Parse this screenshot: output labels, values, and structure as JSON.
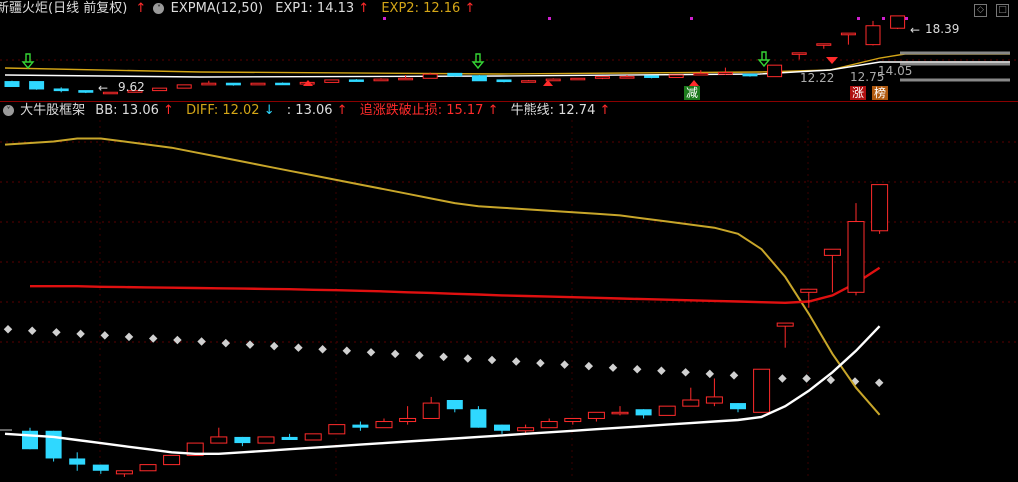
{
  "top_legend": {
    "stock_name": "新疆火炬(日线 前复权)",
    "arrow": "🠙",
    "indicator": "EXPMA(12,50)",
    "exp1_label": "EXP1: 14.13",
    "exp1_arrow": "↑",
    "exp2_label": "EXP2: 12.16",
    "exp2_arrow": "↑"
  },
  "top_labels": {
    "high_price": "18.39",
    "low_price": "9.62",
    "price_a": "12.22",
    "price_b": "12.75",
    "price_c": "14.05",
    "signal_reduce": "减",
    "signal_rise": "涨",
    "signal_list": "榜"
  },
  "bottom_legend": {
    "indicator": "大牛股框架",
    "bb_label": "BB: 13.06",
    "bb_arrow": "↑",
    "diff_label": "DIFF: 12.02",
    "diff_arrow": "↓",
    "third_label": ": 13.06",
    "third_arrow": "↑",
    "stop_label": "追涨跌破止损: 15.17",
    "stop_arrow": "↑",
    "bear_label": "牛熊线: 12.74",
    "bear_arrow": "↑"
  },
  "colors": {
    "up": "#ff2b2b",
    "down": "#2fd8ff",
    "exp2": "#d4a617",
    "diff": "#c8a62a",
    "stop": "#e01010",
    "bear": "#ffffff",
    "dots": "#d0d0d0"
  },
  "icons": {
    "collapse": "circle-chevron-icon",
    "settings": "circle-chevron-icon",
    "window": "window-control-icons"
  },
  "chart_data": {
    "type": "candlestick",
    "panels": [
      "price-overview",
      "大牛股框架"
    ],
    "candles": [
      {
        "o": 10.9,
        "c": 11.5,
        "h": 11.6,
        "l": 10.9,
        "dir": "down"
      },
      {
        "o": 11.5,
        "c": 10.6,
        "h": 11.5,
        "l": 10.5,
        "dir": "down"
      },
      {
        "o": 10.6,
        "c": 10.4,
        "h": 10.8,
        "l": 10.2,
        "dir": "down"
      },
      {
        "o": 10.4,
        "c": 10.2,
        "h": 10.4,
        "l": 10.1,
        "dir": "down"
      },
      {
        "o": 10.1,
        "c": 10.2,
        "h": 10.2,
        "l": 10.0,
        "dir": "up"
      },
      {
        "o": 10.2,
        "c": 10.4,
        "h": 10.4,
        "l": 10.2,
        "dir": "up"
      },
      {
        "o": 10.4,
        "c": 10.7,
        "h": 10.7,
        "l": 10.4,
        "dir": "up"
      },
      {
        "o": 10.7,
        "c": 11.1,
        "h": 11.1,
        "l": 10.7,
        "dir": "up"
      },
      {
        "o": 11.1,
        "c": 11.3,
        "h": 11.6,
        "l": 11.1,
        "dir": "up"
      },
      {
        "o": 11.3,
        "c": 11.1,
        "h": 11.3,
        "l": 11.0,
        "dir": "down"
      },
      {
        "o": 11.1,
        "c": 11.3,
        "h": 11.3,
        "l": 11.1,
        "dir": "up"
      },
      {
        "o": 11.3,
        "c": 11.2,
        "h": 11.4,
        "l": 11.2,
        "dir": "down"
      },
      {
        "o": 11.2,
        "c": 11.4,
        "h": 11.4,
        "l": 11.2,
        "dir": "up"
      },
      {
        "o": 11.4,
        "c": 11.7,
        "h": 11.7,
        "l": 11.4,
        "dir": "up"
      },
      {
        "o": 11.7,
        "c": 11.6,
        "h": 11.8,
        "l": 11.5,
        "dir": "down"
      },
      {
        "o": 11.6,
        "c": 11.8,
        "h": 11.9,
        "l": 11.6,
        "dir": "up"
      },
      {
        "o": 11.8,
        "c": 11.9,
        "h": 12.3,
        "l": 11.7,
        "dir": "up"
      },
      {
        "o": 11.9,
        "c": 12.4,
        "h": 12.6,
        "l": 11.9,
        "dir": "up"
      },
      {
        "o": 12.5,
        "c": 12.2,
        "h": 12.5,
        "l": 12.1,
        "dir": "down"
      },
      {
        "o": 12.2,
        "c": 11.6,
        "h": 12.3,
        "l": 11.6,
        "dir": "down"
      },
      {
        "o": 11.7,
        "c": 11.5,
        "h": 11.7,
        "l": 11.4,
        "dir": "down"
      },
      {
        "o": 11.5,
        "c": 11.6,
        "h": 11.7,
        "l": 11.4,
        "dir": "up"
      },
      {
        "o": 11.6,
        "c": 11.8,
        "h": 11.9,
        "l": 11.6,
        "dir": "up"
      },
      {
        "o": 11.8,
        "c": 11.9,
        "h": 11.9,
        "l": 11.7,
        "dir": "up"
      },
      {
        "o": 11.9,
        "c": 12.1,
        "h": 12.1,
        "l": 11.8,
        "dir": "up"
      },
      {
        "o": 12.1,
        "c": 12.1,
        "h": 12.3,
        "l": 12.0,
        "dir": "up"
      },
      {
        "o": 12.2,
        "c": 12.0,
        "h": 12.2,
        "l": 11.9,
        "dir": "down"
      },
      {
        "o": 12.0,
        "c": 12.3,
        "h": 12.3,
        "l": 12.0,
        "dir": "up"
      },
      {
        "o": 12.3,
        "c": 12.5,
        "h": 12.9,
        "l": 12.3,
        "dir": "up"
      },
      {
        "o": 12.4,
        "c": 12.6,
        "h": 13.2,
        "l": 12.3,
        "dir": "up"
      },
      {
        "o": 12.4,
        "c": 12.2,
        "h": 12.4,
        "l": 12.1,
        "dir": "down"
      },
      {
        "o": 12.1,
        "c": 13.5,
        "h": 13.5,
        "l": 12.1,
        "dir": "up"
      },
      {
        "o": 14.9,
        "c": 15.0,
        "h": 15.0,
        "l": 14.2,
        "dir": "up"
      },
      {
        "o": 16.0,
        "c": 16.1,
        "h": 16.1,
        "l": 15.5,
        "dir": "up"
      },
      {
        "o": 17.2,
        "c": 17.4,
        "h": 17.4,
        "l": 16.0,
        "dir": "up"
      },
      {
        "o": 16.0,
        "c": 18.3,
        "h": 18.9,
        "l": 15.9,
        "dir": "up"
      },
      {
        "o": 18.0,
        "c": 19.5,
        "h": 19.5,
        "l": 17.9,
        "dir": "up"
      }
    ],
    "bear_line": [
      11.4,
      11.3,
      11.2,
      11.1,
      11.0,
      10.9,
      10.8,
      10.75,
      10.75,
      10.8,
      10.85,
      10.9,
      10.95,
      11.0,
      11.05,
      11.1,
      11.15,
      11.2,
      11.25,
      11.3,
      11.35,
      11.4,
      11.45,
      11.5,
      11.55,
      11.6,
      11.65,
      11.7,
      11.75,
      11.8,
      11.85,
      11.95,
      12.3,
      12.8,
      13.4,
      14.1,
      14.9
    ],
    "dots": [
      14.8,
      14.75,
      14.7,
      14.65,
      14.6,
      14.55,
      14.5,
      14.45,
      14.4,
      14.35,
      14.3,
      14.25,
      14.2,
      14.15,
      14.1,
      14.05,
      14.0,
      13.95,
      13.9,
      13.85,
      13.8,
      13.75,
      13.7,
      13.65,
      13.6,
      13.55,
      13.5,
      13.45,
      13.4,
      13.35,
      13.3,
      13.25,
      13.2,
      13.2,
      13.15,
      13.1,
      13.06
    ],
    "stop_line": [
      16.2,
      16.2,
      16.2,
      16.18,
      16.17,
      16.16,
      16.15,
      16.14,
      16.13,
      16.12,
      16.11,
      16.1,
      16.08,
      16.07,
      16.05,
      16.03,
      16.0,
      15.98,
      15.95,
      15.93,
      15.9,
      15.88,
      15.86,
      15.84,
      15.82,
      15.8,
      15.78,
      15.76,
      15.74,
      15.72,
      15.7,
      15.68,
      15.66,
      15.7,
      15.9,
      16.3,
      16.8
    ],
    "diff_line": [
      20.8,
      20.9,
      21.0,
      21.0,
      20.9,
      20.8,
      20.7,
      20.55,
      20.4,
      20.25,
      20.1,
      19.95,
      19.8,
      19.65,
      19.5,
      19.35,
      19.2,
      19.05,
      18.9,
      18.8,
      18.75,
      18.7,
      18.65,
      18.6,
      18.55,
      18.5,
      18.4,
      18.3,
      18.2,
      18.1,
      17.9,
      17.4,
      16.5,
      15.3,
      14.0,
      12.9,
      12.02
    ],
    "ylim": [
      9.9,
      21.6
    ]
  }
}
